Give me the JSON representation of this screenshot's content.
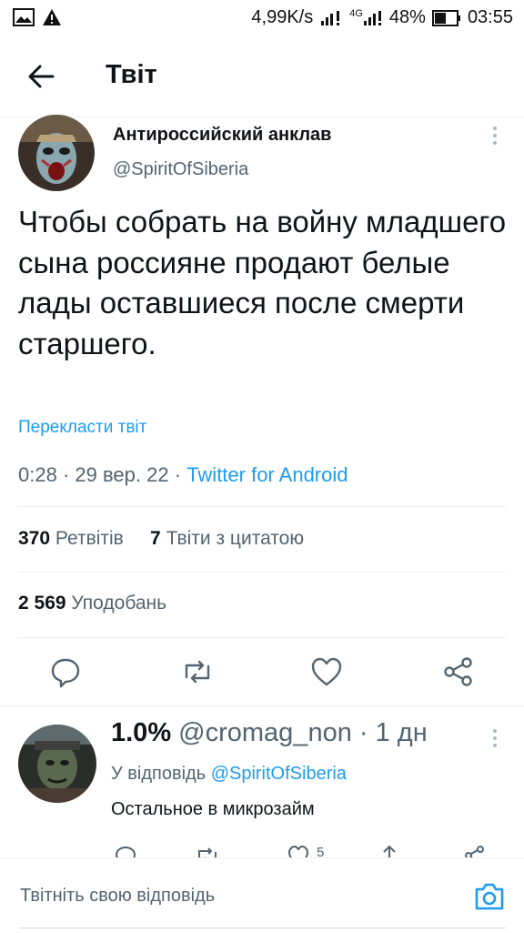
{
  "status_bar": {
    "network_speed": "4,99K/s",
    "network_type": "4G",
    "battery": "48%",
    "time": "03:55",
    "icons": [
      "image-icon",
      "warning-icon",
      "signal-icon",
      "signal-4g-icon",
      "battery-icon"
    ]
  },
  "header": {
    "title": "Твіт",
    "back_icon": "arrow-left-icon"
  },
  "tweet": {
    "author_name": "Антироссийский анклав",
    "author_handle": "@SpiritOfSiberia",
    "text": "Чтобы собрать на войну младшего сына россияне продают белые лады оставшиеся после смерти старшего.",
    "translate_label": "Перекласти твіт",
    "time": "0:28",
    "date": "29 вер. 22",
    "separator": "·",
    "source": "Twitter for Android",
    "retweets_count": "370",
    "retweets_label": "Ретвітів",
    "quotes_count": "7",
    "quotes_label": "Твіти з цитатою",
    "likes_count": "2 569",
    "likes_label": "Уподобань",
    "actions": [
      "reply-icon",
      "retweet-icon",
      "like-icon",
      "share-icon"
    ]
  },
  "reply": {
    "author_name": "1.0%",
    "author_handle": "@cromag_non",
    "separator": "·",
    "time": "1 дн",
    "replying_to_label": "У відповідь",
    "replying_to_handle": "@SpiritOfSiberia",
    "text": "Остальное в микрозайм",
    "like_count": "5"
  },
  "compose": {
    "placeholder": "Твітніть свою відповідь",
    "camera_icon": "camera-icon"
  },
  "colors": {
    "accent": "#1d9bf0",
    "secondary_text": "#536471",
    "primary_text": "#0f1419"
  }
}
